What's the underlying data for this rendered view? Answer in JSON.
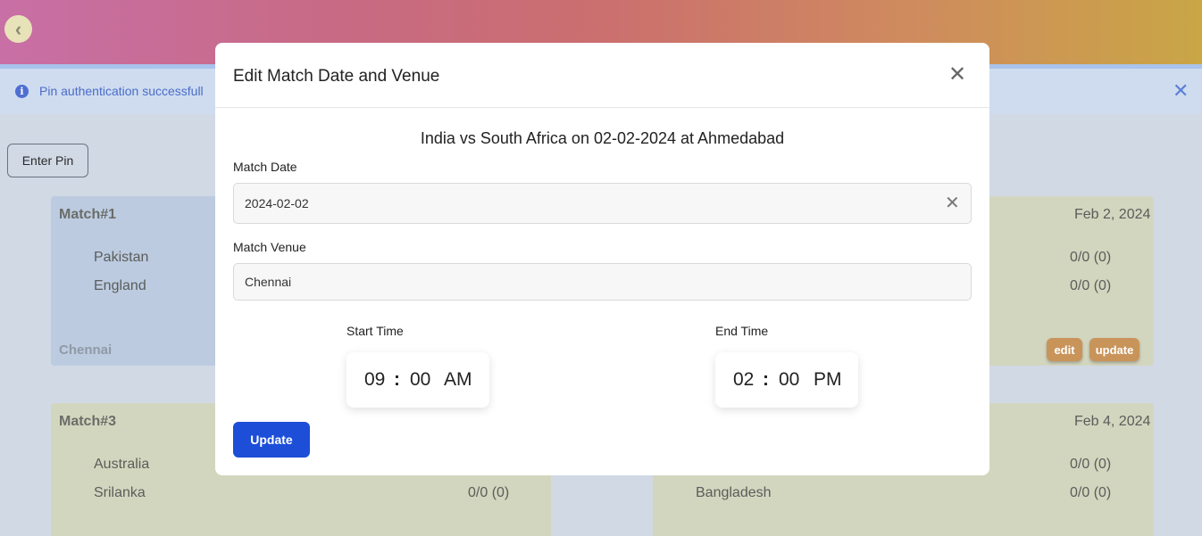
{
  "header": {
    "back_icon": "chevron-left-icon"
  },
  "alert": {
    "message": "Pin authentication successfull",
    "icon": "info-icon",
    "close_icon": "close-icon"
  },
  "enter_pin_label": "Enter Pin",
  "matches": [
    {
      "title": "Match#1",
      "date": "Feb 2, 2024",
      "team1": "Pakistan",
      "team2": "England",
      "score1": "0/0 (0)",
      "score2": "0/0 (0)",
      "venue": "Chennai",
      "edit_label": "edit",
      "update_label": "update"
    },
    {
      "title": "Match#3",
      "date": "Feb 4, 2024",
      "team1": "Australia",
      "team2": "Srilanka",
      "score1": "0/0 (0)",
      "score2": "0/0 (0)",
      "score_left2": "0/0 (0)",
      "team_right2": "Bangladesh"
    }
  ],
  "modal": {
    "title": "Edit Match Date and Venue",
    "close_icon": "close-icon",
    "match_heading": "India vs South Africa on 02-02-2024 at Ahmedabad",
    "date_label": "Match Date",
    "date_value": "2024-02-02",
    "venue_label": "Match Venue",
    "venue_value": "Chennai",
    "start_label": "Start Time",
    "start": {
      "hour": "09",
      "minute": "00",
      "period": "AM"
    },
    "end_label": "End Time",
    "end": {
      "hour": "02",
      "minute": "00",
      "period": "PM"
    },
    "update_label": "Update"
  }
}
